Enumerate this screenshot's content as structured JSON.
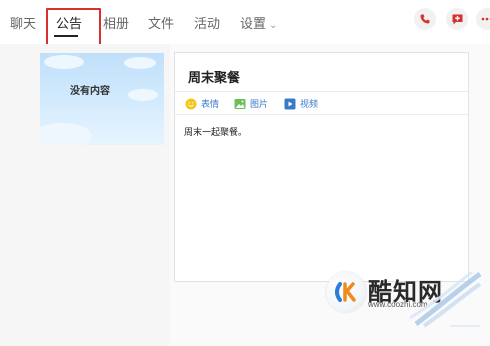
{
  "tabs": [
    {
      "label": "聊天"
    },
    {
      "label": "公告"
    },
    {
      "label": "相册"
    },
    {
      "label": "文件"
    },
    {
      "label": "活动"
    },
    {
      "label": "设置"
    }
  ],
  "active_tab": "公告",
  "header_buttons": [
    {
      "icon": "phone-icon",
      "color": "#d8302e"
    },
    {
      "icon": "chat-add-icon",
      "color": "#d8302e"
    },
    {
      "icon": "more-icon",
      "color": "#d8302e"
    }
  ],
  "empty_state": {
    "text": "没有内容"
  },
  "editor": {
    "title": "周末聚餐",
    "toolbar": [
      {
        "label": "表情",
        "icon": "emoji-icon"
      },
      {
        "label": "图片",
        "icon": "image-icon"
      },
      {
        "label": "视频",
        "icon": "video-icon"
      }
    ],
    "body": "周末一起聚餐。"
  },
  "watermark": {
    "logo_letter": "K",
    "name": "酷知网",
    "url": "www.coozhi.com"
  },
  "colors": {
    "accent": "#d8302e",
    "link": "#3a7bc8"
  }
}
